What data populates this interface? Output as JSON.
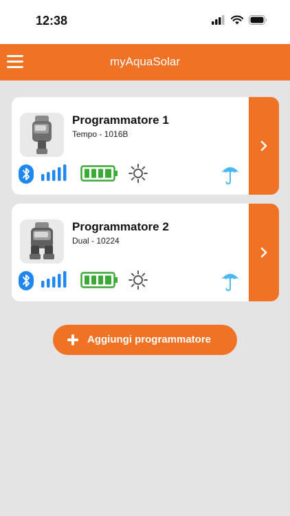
{
  "status_bar": {
    "time": "12:38"
  },
  "nav": {
    "title": "myAquaSolar",
    "menu_icon": "hamburger-icon"
  },
  "programmers": [
    {
      "title": "Programmatore 1",
      "subtitle": "Tempo - 1016B"
    },
    {
      "title": "Programmatore 2",
      "subtitle": "Dual - 10224"
    }
  ],
  "icons": {
    "bluetooth": "bluetooth-icon",
    "signal": "signal-bars-icon",
    "battery": "battery-full-icon",
    "sun": "sun-icon",
    "rain": "umbrella-rain-icon",
    "chevron": "chevron-right-icon"
  },
  "levels": {
    "signal": 1.0,
    "battery": 1.0
  },
  "add_button": {
    "label": "Aggiungi programmatore"
  },
  "colors": {
    "accent": "#f07325",
    "bluetooth": "#1e88f0",
    "signal": "#1e88f0",
    "battery": "#3aa935",
    "rain": "#4cb8f0"
  }
}
